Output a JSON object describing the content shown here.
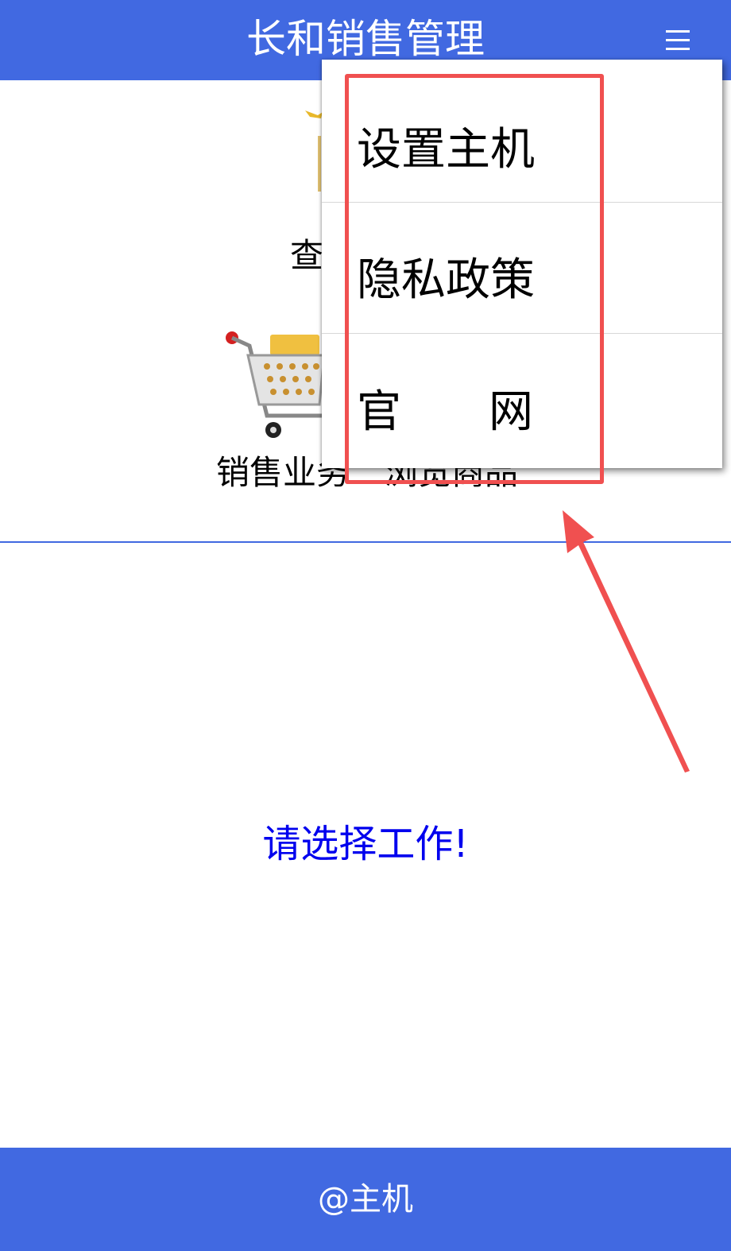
{
  "header": {
    "title": "长和销售管理",
    "menu_icon": "hamburger-menu-icon"
  },
  "main": {
    "query_label": "查",
    "sales_label": "销售业务",
    "browse_label": "浏览商品",
    "prompt": "请选择工作!"
  },
  "dropdown": {
    "items": [
      {
        "label": "设置主机"
      },
      {
        "label": "隐私政策"
      },
      {
        "label_left": "官",
        "label_right": "网"
      }
    ]
  },
  "footer": {
    "text": "@主机"
  },
  "colors": {
    "brand": "#4169e1",
    "prompt": "#0000ee",
    "annotation": "#f05050"
  }
}
